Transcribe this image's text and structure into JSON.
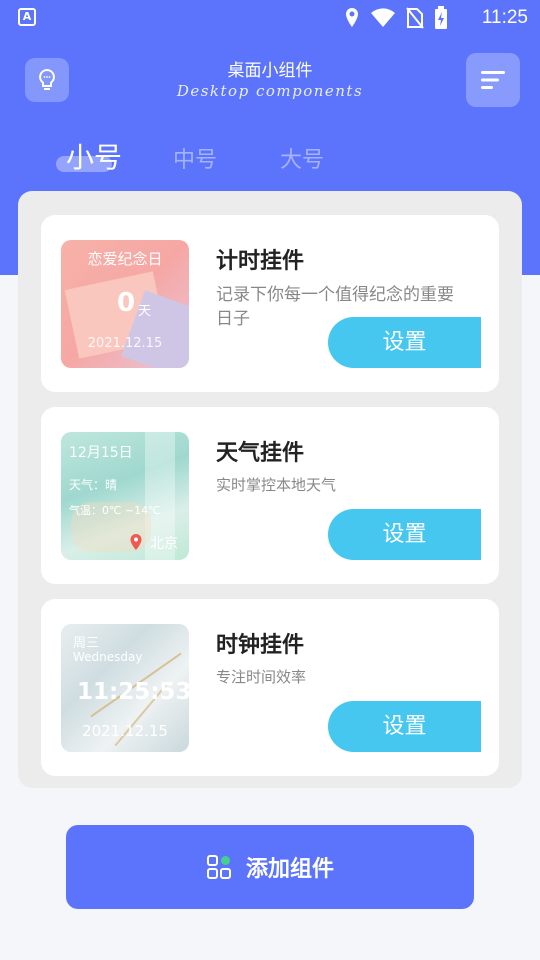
{
  "status_bar": {
    "time": "11:25",
    "notif_letter": "A"
  },
  "header": {
    "title": "桌面小组件",
    "subtitle": "Desktop  components"
  },
  "tabs": [
    {
      "label": "小号",
      "active": true
    },
    {
      "label": "中号",
      "active": false
    },
    {
      "label": "大号",
      "active": false
    }
  ],
  "cards": [
    {
      "title": "计时挂件",
      "desc": "记录下你每一个值得纪念的重要日子",
      "button": "设置",
      "thumb": {
        "heading": "恋爱纪念日",
        "count": "0",
        "unit": "天",
        "date": "2021.12.15"
      }
    },
    {
      "title": "天气挂件",
      "desc": "实时掌控本地天气",
      "button": "设置",
      "thumb": {
        "date": "12月15日",
        "weather": "天气：晴",
        "temp": "气温：0℃ ~14℃",
        "city": "北京"
      }
    },
    {
      "title": "时钟挂件",
      "desc": "专注时间效率",
      "button": "设置",
      "thumb": {
        "weekday_cn": "周三",
        "weekday_en": "Wednesday",
        "time": "11:25:53",
        "date": "2021.12.15"
      }
    }
  ],
  "add_button": {
    "label": "添加组件"
  },
  "colors": {
    "primary": "#5b74fb",
    "button": "#45c7ef",
    "background": "#f4f6fa"
  }
}
